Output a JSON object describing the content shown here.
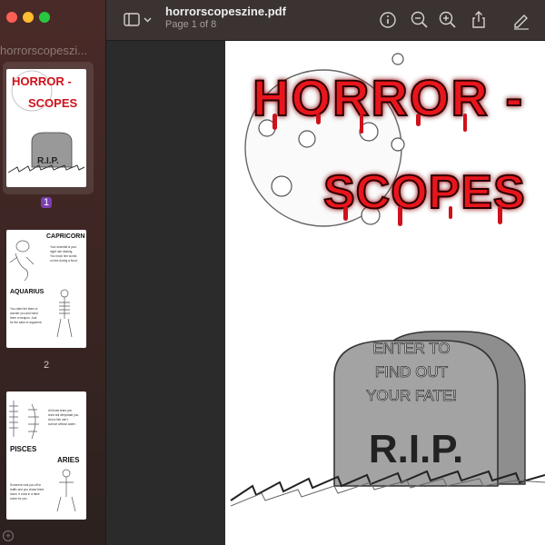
{
  "window": {
    "title": "horrorscopeszine.pdf",
    "subtitle": "Page 1 of 8"
  },
  "sidebar": {
    "title": "horrorscopeszi...",
    "pages": [
      {
        "number": "1"
      },
      {
        "number": "2"
      }
    ],
    "thumb2": {
      "sign1": "CAPRICORN",
      "text1": "Your downfall is your night rain dealing. You mock him words on ties during a flood.",
      "sign2": "AQUARIUS",
      "text2": "You claim the stars to wander you and hand them a weapon. Just for the sake of argument."
    },
    "thumb3": {
      "text1": "All those tears you shed will dehydrate you. And a fish can't survive without water.",
      "sign1": "PISCES",
      "sign2": "ARIES",
      "text2": "Someone cuts you off in traffic and you chase them down. It ends in a false crash for you."
    }
  },
  "toolbar": {
    "sidebar_icon": "sidebar-icon",
    "info_icon": "info-icon",
    "zoom_out_icon": "zoom-out-icon",
    "zoom_in_icon": "zoom-in-icon",
    "share_icon": "share-icon",
    "markup_icon": "markup-icon"
  },
  "page": {
    "title_line1": "HORROR -",
    "title_line2": "SCOPES",
    "stone_line1": "ENTER TO",
    "stone_line2": "FIND OUT",
    "stone_line3": "YOUR FATE!",
    "stone_rip": "R.I.P.",
    "accent": "#e8141c"
  }
}
